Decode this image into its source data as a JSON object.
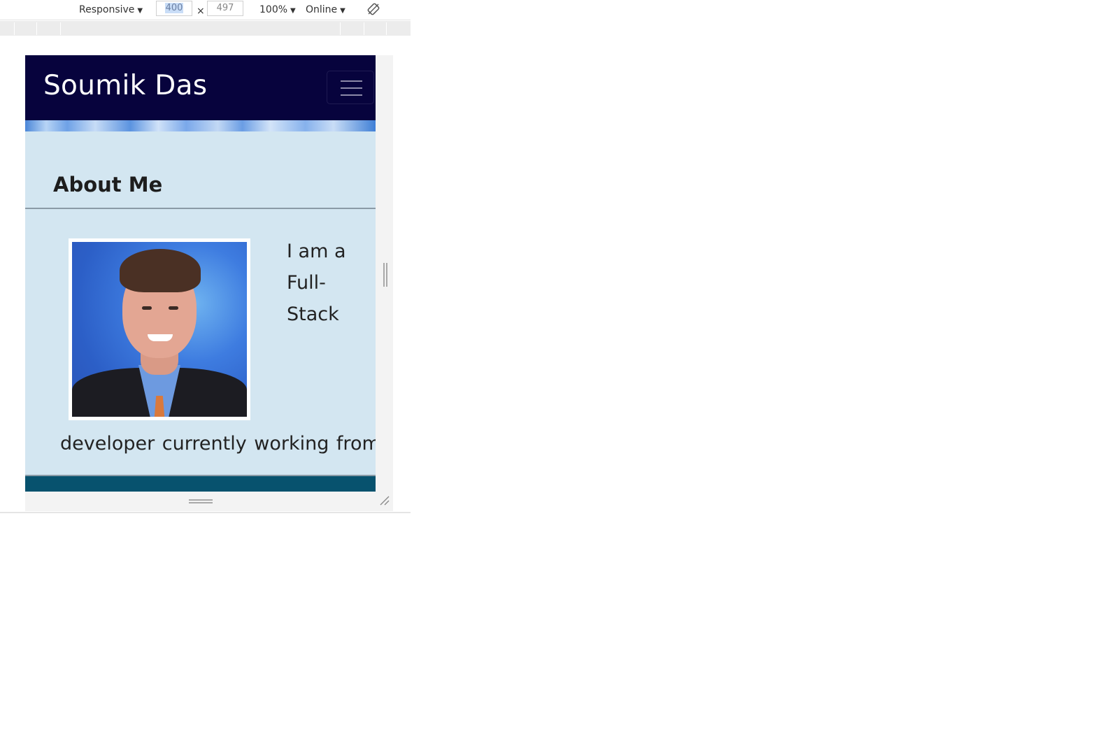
{
  "devtools": {
    "device_mode": "Responsive",
    "width_value": "400",
    "times_sign": "×",
    "height_value": "497",
    "zoom": "100%",
    "throttle": "Online",
    "rotate_icon": "rotate-icon",
    "caret": "▼"
  },
  "site": {
    "brand": "Soumik Das",
    "menu_icon": "hamburger-icon",
    "colors": {
      "navbar": "#07033d",
      "page_background": "#d3e6f1",
      "footer": "#07526e"
    }
  },
  "about": {
    "title": "About Me",
    "intro_lines": [
      "I am a",
      "Full-",
      "Stack"
    ],
    "intro_continuation": "developer currently working from"
  }
}
